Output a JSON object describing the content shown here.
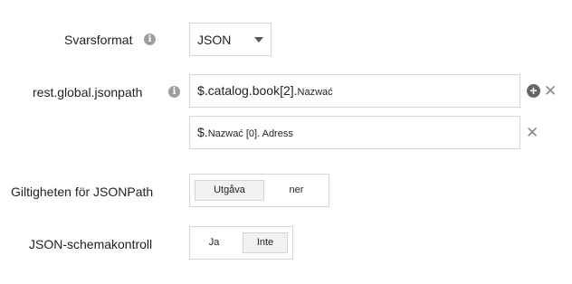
{
  "fields": {
    "response_format": {
      "label": "Svarsformat",
      "info_icon": "info-icon",
      "value": "JSON"
    },
    "jsonpath": {
      "label": "rest.global.jsonpath",
      "info_icon": "info-icon",
      "paths": [
        {
          "prefix": "$.catalog.book[2].",
          "suffix": "Nazwać"
        },
        {
          "prefix": "$.",
          "mid": "Nazwać",
          "suffix": " [0]. Adress"
        }
      ],
      "add_icon": "plus-circle-icon",
      "remove_icon": "close-icon"
    },
    "jsonpath_validity": {
      "label": "Giltigheten för JSONPath",
      "options": [
        "Utgåva",
        "ner"
      ],
      "selected": "Utgåva"
    },
    "schema_check": {
      "label": "JSON-schemakontroll",
      "options": [
        "Ja",
        "Inte"
      ],
      "selected": "Inte"
    }
  }
}
